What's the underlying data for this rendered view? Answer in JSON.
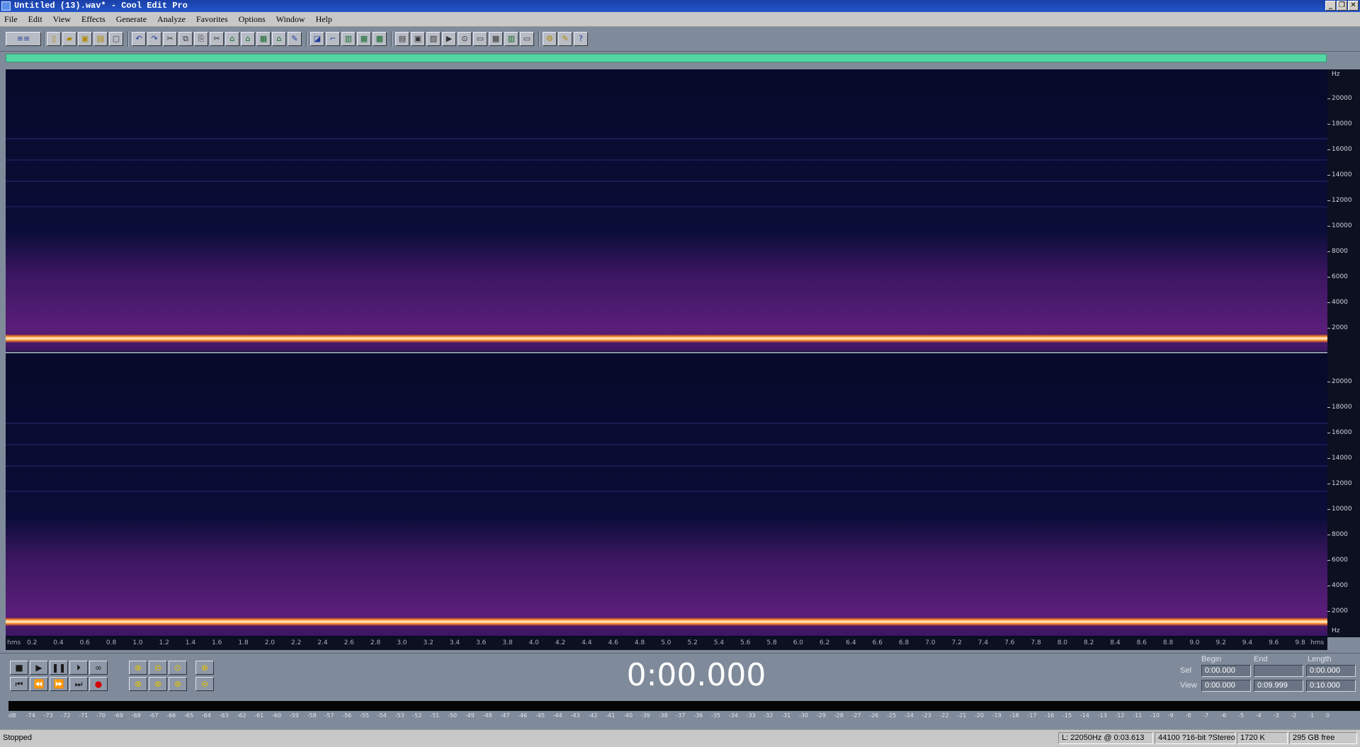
{
  "window": {
    "title": "Untitled (13).wav* - Cool Edit Pro",
    "minimize_glyph": "_",
    "restore_glyph": "❐",
    "close_glyph": "✕"
  },
  "menu": {
    "items": [
      "File",
      "Edit",
      "View",
      "Effects",
      "Generate",
      "Analyze",
      "Favorites",
      "Options",
      "Window",
      "Help"
    ]
  },
  "toolbar": {
    "icons": [
      "multitrack-icon",
      "new-icon",
      "open-icon",
      "save-icon",
      "save-as-icon",
      "close-file-icon",
      "undo-icon",
      "redo-icon",
      "cut-icon",
      "copy-icon",
      "paste-icon",
      "mix-paste-icon",
      "trim-icon",
      "silence-icon",
      "insert-icon",
      "convert-icon",
      "edit-icon",
      "waveform-view-icon",
      "spectral-view-icon",
      "bars-icon",
      "grid-icon",
      "settings-icon",
      "cue-icon",
      "snap-icon",
      "play-cue-icon",
      "zoom-tool-icon",
      "time-icon",
      "frame-icon",
      "meter-icon",
      "info-icon",
      "properties-icon",
      "batch-icon",
      "help-icon"
    ]
  },
  "spectrogram": {
    "hz_unit_top": "Hz",
    "hz_unit_bottom": "Hz",
    "hz_ticks_channel1": [
      "20000",
      "18000",
      "16000",
      "14000",
      "12000",
      "10000",
      "8000",
      "6000",
      "4000",
      "2000"
    ],
    "hz_ticks_channel2": [
      "20000",
      "18000",
      "16000",
      "14000",
      "12000",
      "10000",
      "8000",
      "6000",
      "4000",
      "2000"
    ],
    "tone_color": "#fff6d8",
    "noise_color": "#5a1e7a",
    "background_color": "#070a2a"
  },
  "time_ruler": {
    "start_label": "hms",
    "end_label": "hms",
    "ticks": [
      "0.2",
      "0.4",
      "0.6",
      "0.8",
      "1.0",
      "1.2",
      "1.4",
      "1.6",
      "1.8",
      "2.0",
      "2.2",
      "2.4",
      "2.6",
      "2.8",
      "3.0",
      "3.2",
      "3.4",
      "3.6",
      "3.8",
      "4.0",
      "4.2",
      "4.4",
      "4.6",
      "4.8",
      "5.0",
      "5.2",
      "5.4",
      "5.6",
      "5.8",
      "6.0",
      "6.2",
      "6.4",
      "6.6",
      "6.8",
      "7.0",
      "7.2",
      "7.4",
      "7.6",
      "7.8",
      "8.0",
      "8.2",
      "8.4",
      "8.6",
      "8.8",
      "9.0",
      "9.2",
      "9.4",
      "9.6",
      "9.8"
    ]
  },
  "transport": {
    "stop_glyph": "■",
    "play_glyph": "▶",
    "pause_glyph": "❚❚",
    "play_to_end_glyph": "⏵",
    "loop_glyph": "∞",
    "go_start_glyph": "⏮",
    "rewind_glyph": "⏪",
    "forward_glyph": "⏩",
    "go_end_glyph": "⏭",
    "record_glyph": "●",
    "zoom_in_h_glyph": "⊕",
    "zoom_out_h_glyph": "⊖",
    "zoom_full_glyph": "⊙",
    "zoom_in_v_glyph": "⊕",
    "zoom_sel_glyph": "⊕",
    "zoom_left_glyph": "⊕",
    "zoom_right_glyph": "⊕",
    "zoom_out_v_glyph": "⊖"
  },
  "time_display": "0:00.000",
  "selection": {
    "headers": {
      "begin": "Begin",
      "end": "End",
      "length": "Length"
    },
    "sel_label": "Sel",
    "view_label": "View",
    "sel": {
      "begin": "0:00.000",
      "end": "",
      "length": "0:00.000"
    },
    "view": {
      "begin": "0:00.000",
      "end": "0:09.999",
      "length": "0:10.000"
    }
  },
  "level_meter": {
    "labels": [
      "dB",
      "-74",
      "-73",
      "-72",
      "-71",
      "-70",
      "-69",
      "-68",
      "-67",
      "-66",
      "-65",
      "-64",
      "-63",
      "-62",
      "-61",
      "-60",
      "-59",
      "-58",
      "-57",
      "-56",
      "-55",
      "-54",
      "-53",
      "-52",
      "-51",
      "-50",
      "-49",
      "-48",
      "-47",
      "-46",
      "-45",
      "-44",
      "-43",
      "-42",
      "-41",
      "-40",
      "-39",
      "-38",
      "-37",
      "-36",
      "-35",
      "-34",
      "-33",
      "-32",
      "-31",
      "-30",
      "-29",
      "-28",
      "-27",
      "-26",
      "-25",
      "-24",
      "-23",
      "-22",
      "-21",
      "-20",
      "-19",
      "-18",
      "-17",
      "-16",
      "-15",
      "-14",
      "-13",
      "-12",
      "-11",
      "-10",
      "-9",
      "-8",
      "-7",
      "-6",
      "-5",
      "-4",
      "-3",
      "-2",
      "-1",
      "0"
    ]
  },
  "status": {
    "state": "Stopped",
    "cursor": "L: 22050Hz @ 0:03.613",
    "format": "44100 ?16-bit ?Stereo",
    "size": "1720 K",
    "free": "295 GB free"
  }
}
